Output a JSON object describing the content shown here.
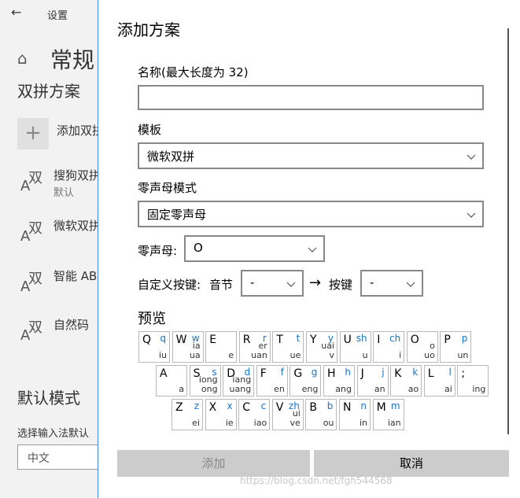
{
  "background": {
    "back_icon": "←",
    "settings_label": "设置",
    "home_icon": "⌂",
    "page_title": "常规",
    "section_title": "双拼方案",
    "add_icon": "+",
    "add_label": "添加双拼",
    "scheme_icon_a": "A",
    "scheme_icon_s": "双",
    "schemes": [
      {
        "name": "搜狗双拼",
        "sub": "默认"
      },
      {
        "name": "微软双拼",
        "sub": ""
      },
      {
        "name": "智能 AB",
        "sub": ""
      },
      {
        "name": "自然码",
        "sub": ""
      }
    ],
    "default_mode_title": "默认模式",
    "select_label": "选择输入法默认",
    "language_value": "中文"
  },
  "dialog": {
    "title": "添加方案",
    "name_label": "名称(最大长度为 32)",
    "name_value": "",
    "template_label": "模板",
    "template_value": "微软双拼",
    "zero_mode_label": "零声母模式",
    "zero_mode_value": "固定零声母",
    "zero_initial_label": "零声母:",
    "zero_initial_value": "O",
    "custom_key_label": "自定义按键:",
    "syllable_label": "音节",
    "syllable_value": "-",
    "arrow": "→",
    "key_label": "按键",
    "key_value": "-",
    "preview_label": "预览",
    "add_button": "添加",
    "cancel_button": "取消"
  },
  "keyboard": {
    "rows": [
      [
        {
          "key": "Q",
          "sheng": "q",
          "fin": "iu"
        },
        {
          "key": "W",
          "sheng": "w",
          "fin": "ia\nua"
        },
        {
          "key": "E",
          "sheng": "",
          "fin": "e"
        },
        {
          "key": "R",
          "sheng": "r",
          "fin": "er\nuan"
        },
        {
          "key": "T",
          "sheng": "t",
          "fin": "ue"
        },
        {
          "key": "Y",
          "sheng": "y",
          "fin": "uai\nv"
        },
        {
          "key": "U",
          "sheng": "sh",
          "fin": "u"
        },
        {
          "key": "I",
          "sheng": "ch",
          "fin": "i"
        },
        {
          "key": "O",
          "sheng": "",
          "fin": "o\nuo"
        },
        {
          "key": "P",
          "sheng": "p",
          "fin": "un"
        }
      ],
      [
        {
          "key": "A",
          "sheng": "",
          "fin": "a"
        },
        {
          "key": "S",
          "sheng": "s",
          "fin": "iong\nong"
        },
        {
          "key": "D",
          "sheng": "d",
          "fin": "iang\nuang"
        },
        {
          "key": "F",
          "sheng": "f",
          "fin": "en"
        },
        {
          "key": "G",
          "sheng": "g",
          "fin": "eng"
        },
        {
          "key": "H",
          "sheng": "h",
          "fin": "ang"
        },
        {
          "key": "J",
          "sheng": "j",
          "fin": "an"
        },
        {
          "key": "K",
          "sheng": "k",
          "fin": "ao"
        },
        {
          "key": "L",
          "sheng": "l",
          "fin": "ai"
        },
        {
          "key": ";",
          "sheng": "",
          "fin": "ing"
        }
      ],
      [
        {
          "key": "Z",
          "sheng": "z",
          "fin": "ei"
        },
        {
          "key": "X",
          "sheng": "x",
          "fin": "ie"
        },
        {
          "key": "C",
          "sheng": "c",
          "fin": "iao"
        },
        {
          "key": "V",
          "sheng": "zh",
          "fin": "ui\nve"
        },
        {
          "key": "B",
          "sheng": "b",
          "fin": "ou"
        },
        {
          "key": "N",
          "sheng": "n",
          "fin": "in"
        },
        {
          "key": "M",
          "sheng": "m",
          "fin": "ian"
        }
      ]
    ]
  },
  "watermark": "https://blog.csdn.net/fgh544568",
  "colors": {
    "accent_border": "#3a8bd6",
    "sheng_blue": "#1a73c9",
    "button_gray": "#cccccc"
  }
}
